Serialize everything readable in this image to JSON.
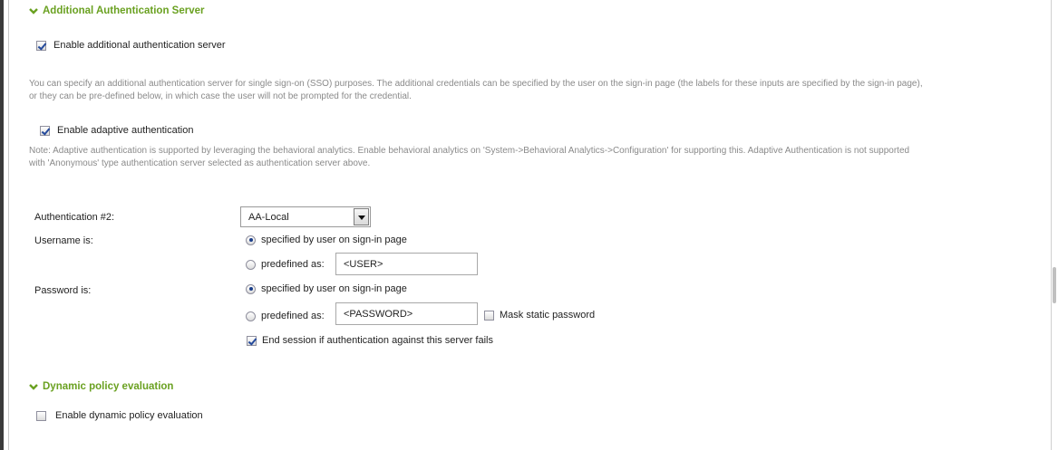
{
  "additional_auth": {
    "header": "Additional Authentication Server",
    "enable_label": "Enable additional authentication server",
    "enable_checked": true,
    "description_line1": "You can specify an additional authentication server for single sign-on (SSO) purposes. The additional credentials can be specified by the user on the sign-in page (the labels for these inputs are specified by the sign-in page),",
    "description_line2": "or they can be pre-defined below, in which case the user will not be prompted for the credential.",
    "adaptive_label": "Enable adaptive authentication",
    "adaptive_checked": true,
    "note_line1": "Note: Adaptive authentication is supported by leveraging the behavioral analytics. Enable behavioral analytics on 'System->Behavioral Analytics->Configuration' for supporting this. Adaptive Authentication is not supported",
    "note_line2": "with 'Anonymous' type authentication server selected as authentication server above.",
    "auth2_label": "Authentication #2:",
    "auth2_value": "AA-Local",
    "username_label": "Username is:",
    "username_option_user": "specified by user on sign-in page",
    "username_option_predefined": "predefined as:",
    "username_predefined_value": "<USER>",
    "password_label": "Password is:",
    "password_option_user": "specified by user on sign-in page",
    "password_option_predefined": "predefined as:",
    "password_predefined_value": "<PASSWORD>",
    "mask_label": "Mask static password",
    "mask_checked": false,
    "end_session_label": "End session if authentication against this server fails",
    "end_session_checked": true
  },
  "dynamic_policy": {
    "header": "Dynamic policy evaluation",
    "enable_label": "Enable dynamic policy evaluation",
    "enable_checked": false
  },
  "colors": {
    "section_header": "#6aa121",
    "description_text": "#8a8a8a"
  },
  "icons": {
    "section_toggle": "chevron-down-icon"
  }
}
